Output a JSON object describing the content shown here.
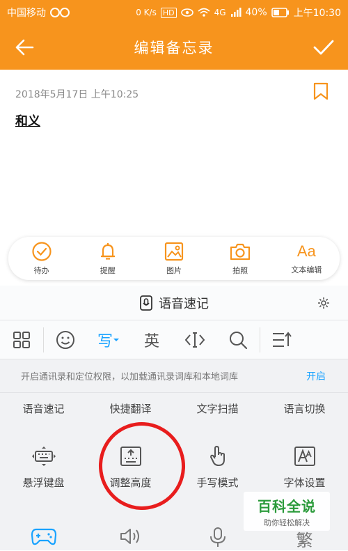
{
  "status_bar": {
    "carrier": "中国移动",
    "net_speed": "0 K/s",
    "hd": "HD",
    "signal": "4G",
    "battery": "40%",
    "time": "上午10:30"
  },
  "app_bar": {
    "title": "编辑备忘录",
    "back_icon": "arrow-left-icon",
    "done_icon": "check-icon"
  },
  "note": {
    "date": "2018年5月17日 上午10:25",
    "content": "和义"
  },
  "note_toolbar": [
    {
      "label": "待办",
      "icon": "todo-check-icon"
    },
    {
      "label": "提醒",
      "icon": "bell-icon"
    },
    {
      "label": "图片",
      "icon": "image-icon"
    },
    {
      "label": "拍照",
      "icon": "camera-icon"
    },
    {
      "label": "文本编辑",
      "icon": "text-format-icon",
      "glyph": "Aa"
    }
  ],
  "voice_bar": {
    "label": "语音速记"
  },
  "keyboard_toolbar": {
    "write": "写",
    "english": "英"
  },
  "notice": {
    "text": "开启通讯录和定位权限，以加载通讯录词库和本地词库",
    "button": "开启"
  },
  "func_row": [
    "语音速记",
    "快捷翻译",
    "文字扫描",
    "语言切换"
  ],
  "grid_row": [
    {
      "label": "悬浮键盘",
      "icon": "floating-keyboard-icon"
    },
    {
      "label": "调整高度",
      "icon": "adjust-height-icon"
    },
    {
      "label": "手写模式",
      "icon": "handwriting-icon"
    },
    {
      "label": "字体设置",
      "icon": "font-settings-icon"
    }
  ],
  "bottom_row": {
    "traditional": "繁"
  },
  "watermark": {
    "title": "百科全说",
    "subtitle": "助你轻松解决"
  },
  "colors": {
    "accent": "#f7941d",
    "keyboard_active": "#1aa3ff",
    "annotation": "#e81d1d"
  }
}
